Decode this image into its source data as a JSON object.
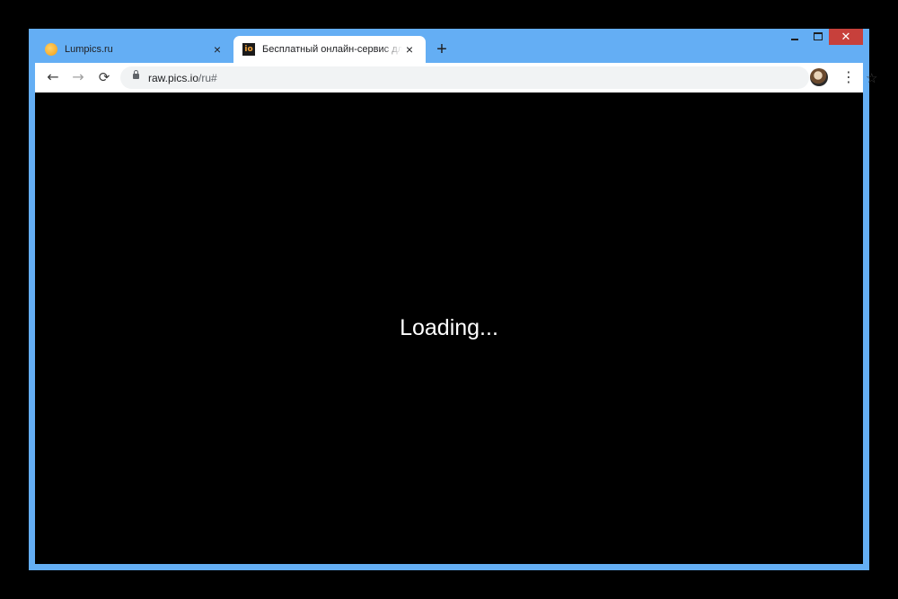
{
  "tabs": [
    {
      "title": "Lumpics.ru",
      "favicon": "orange-favicon",
      "active": false
    },
    {
      "title": "Бесплатный онлайн-сервис для",
      "favicon": "raw-pics-io-favicon",
      "favicon_text": "io",
      "active": true
    }
  ],
  "icons": {
    "close": "×",
    "new_tab": "+",
    "back": "←",
    "forward": "→",
    "reload": "⟳",
    "bookmark": "☆",
    "menu": "⋮",
    "window_close": "✕"
  },
  "address_bar": {
    "host": "raw.pics.io",
    "path": "/ru#"
  },
  "page": {
    "status_text": "Loading..."
  },
  "colors": {
    "window_frame": "#64aef4",
    "close_button": "#c7403b",
    "page_background": "#000000"
  }
}
